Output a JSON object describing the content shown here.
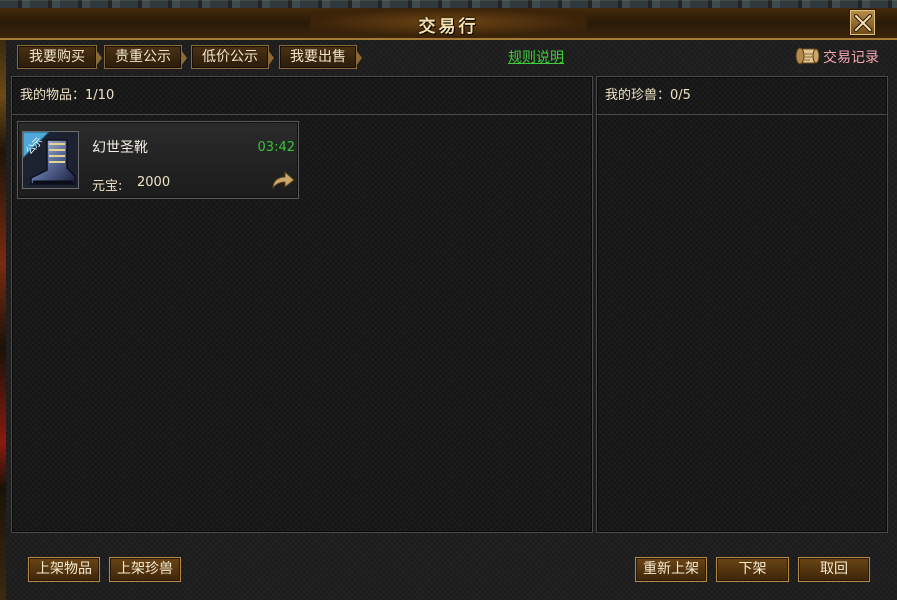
{
  "window": {
    "title": "交易行"
  },
  "tabs": [
    {
      "label": "我要购买"
    },
    {
      "label": "贵重公示"
    },
    {
      "label": "低价公示"
    },
    {
      "label": "我要出售"
    }
  ],
  "rules_link": "规则说明",
  "trade_record": "交易记录",
  "left_panel": {
    "header_label": "我的物品：",
    "count": "1/10",
    "items": [
      {
        "badge": "公示",
        "name": "幻世圣靴",
        "timer": "03:42",
        "price_label": "元宝:",
        "price": "2000"
      }
    ]
  },
  "right_panel": {
    "header_label": "我的珍兽：",
    "count": "0/5"
  },
  "buttons": {
    "list_item": "上架物品",
    "list_pet": "上架珍兽",
    "relist": "重新上架",
    "delist": "下架",
    "retrieve": "取回"
  },
  "colors": {
    "timer": "#38c437",
    "rules_link": "#3fce3a",
    "trade_record": "#f4a7b0"
  }
}
